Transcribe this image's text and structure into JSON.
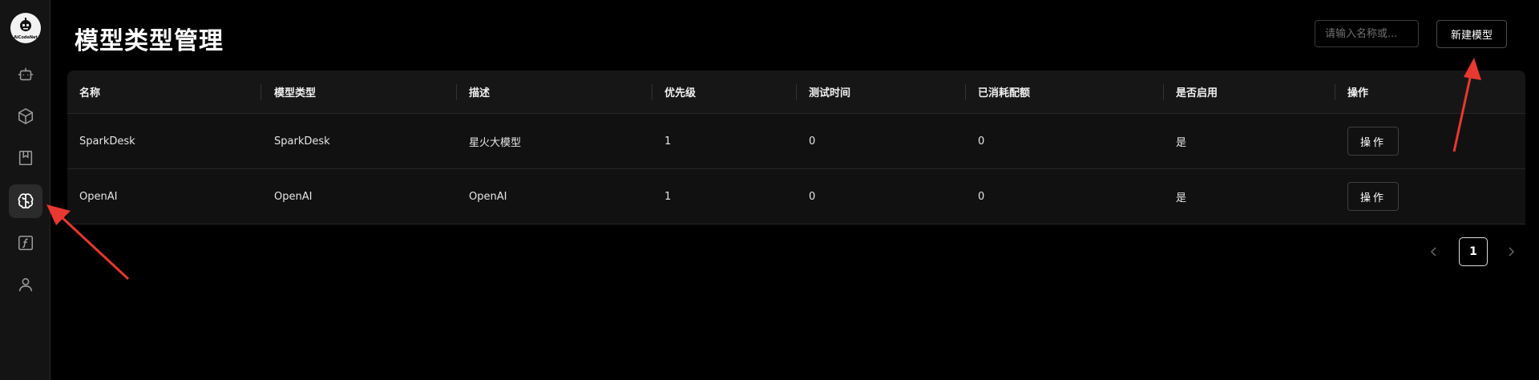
{
  "sidebar": {
    "logo_text": "AiCodeNet",
    "items": [
      {
        "icon": "robot-icon",
        "active": false
      },
      {
        "icon": "cube-icon",
        "active": false
      },
      {
        "icon": "bookmark-icon",
        "active": false
      },
      {
        "icon": "brain-icon",
        "active": true
      },
      {
        "icon": "function-icon",
        "active": false
      },
      {
        "icon": "user-icon",
        "active": false
      }
    ]
  },
  "header": {
    "title": "模型类型管理",
    "search_placeholder": "请输入名称或...",
    "new_button_label": "新建模型"
  },
  "table": {
    "columns": [
      "名称",
      "模型类型",
      "描述",
      "优先级",
      "测试时间",
      "已消耗配额",
      "是否启用",
      "操作"
    ],
    "rows": [
      {
        "name": "SparkDesk",
        "type": "SparkDesk",
        "description": "星火大模型",
        "priority": "1",
        "test_time": "0",
        "quota_used": "0",
        "enabled": "是",
        "action": "操作"
      },
      {
        "name": "OpenAI",
        "type": "OpenAI",
        "description": "OpenAI",
        "priority": "1",
        "test_time": "0",
        "quota_used": "0",
        "enabled": "是",
        "action": "操作"
      }
    ]
  },
  "pagination": {
    "current_page": "1"
  },
  "colors": {
    "background": "#000000",
    "sidebar": "#141414",
    "annotation_arrow": "#e8382f"
  }
}
